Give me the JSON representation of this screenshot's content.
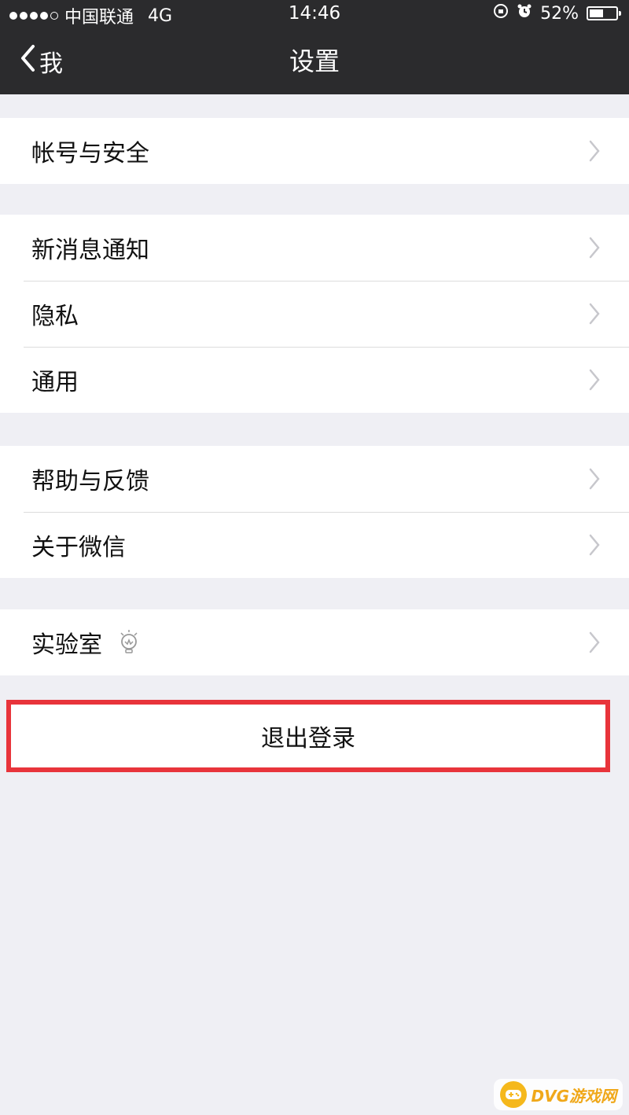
{
  "statusbar": {
    "carrier": "中国联通",
    "network": "4G",
    "time": "14:46",
    "battery_label": "52%",
    "battery_level": 0.52
  },
  "navbar": {
    "back_label": "我",
    "title": "设置"
  },
  "groups": [
    {
      "items": [
        {
          "label": "帐号与安全"
        }
      ]
    },
    {
      "items": [
        {
          "label": "新消息通知"
        },
        {
          "label": "隐私"
        },
        {
          "label": "通用"
        }
      ]
    },
    {
      "items": [
        {
          "label": "帮助与反馈"
        },
        {
          "label": "关于微信"
        }
      ]
    },
    {
      "items": [
        {
          "label": "实验室",
          "icon": "lightbulb-icon"
        }
      ]
    }
  ],
  "logout": {
    "label": "退出登录",
    "highlight_color": "#e8343b"
  },
  "watermark": {
    "text": "DVG游戏网"
  }
}
